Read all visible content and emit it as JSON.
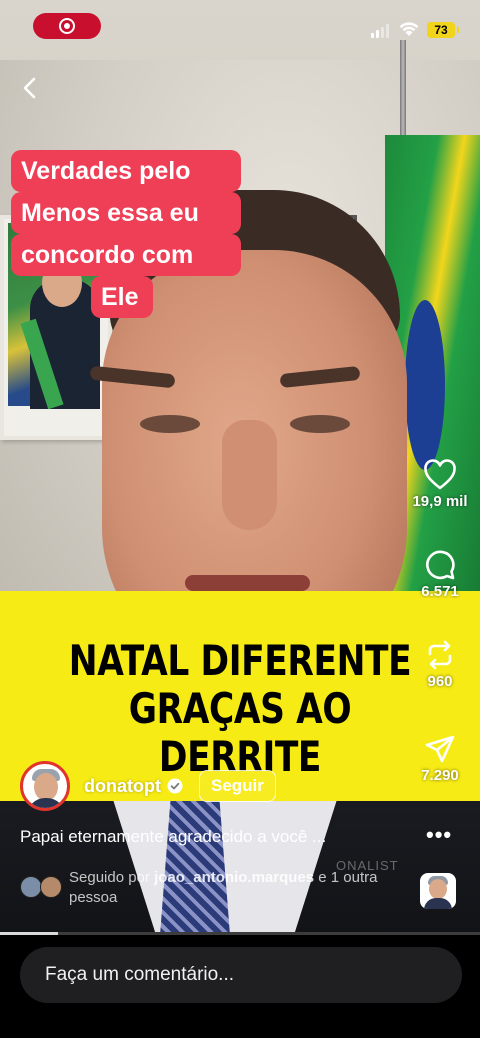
{
  "status_bar": {
    "battery": "73",
    "record_icon": "screen-record-icon"
  },
  "nav": {
    "back_icon": "chevron-left-icon"
  },
  "sticker": {
    "lines": [
      "Verdades pelo",
      "Menos essa eu",
      "concordo com",
      "Ele"
    ],
    "color": "#ef3f57"
  },
  "banner": {
    "line1": "NATAL DIFERENTE",
    "line2": "GRAÇAS AO DERRITE",
    "color": "#f7eb16"
  },
  "actions": {
    "likes": "19,9 mil",
    "comments": "6.571",
    "reposts": "960",
    "shares": "7.290"
  },
  "author": {
    "username": "donatopt",
    "follow_label": "Seguir"
  },
  "post": {
    "caption": "Papai eternamente agradecido a você ...",
    "followed_prefix": "Seguido por",
    "followed_user": "joao_antonio.marques",
    "followed_suffix": "e 1 outra pessoa",
    "watermark": "ONALIST"
  },
  "playback": {
    "progress": 0.12
  },
  "comment": {
    "placeholder": "Faça um comentário..."
  }
}
